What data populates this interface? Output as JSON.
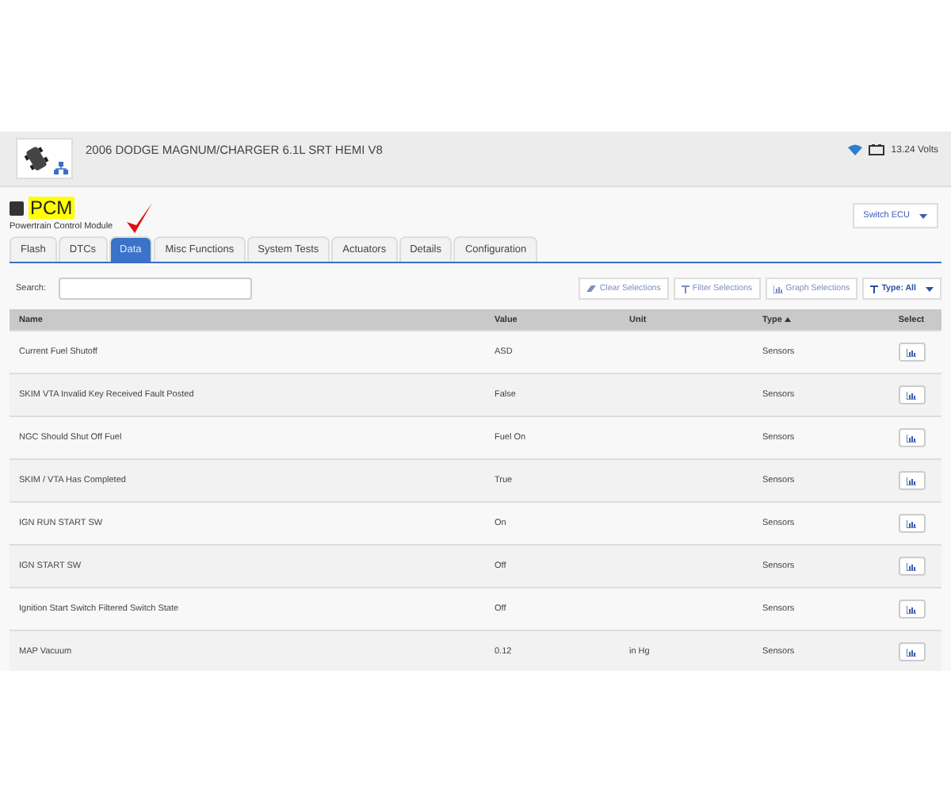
{
  "header": {
    "vehicle": "2006 DODGE MAGNUM/CHARGER 6.1L SRT HEMI V8",
    "voltage": "13.24 Volts"
  },
  "module": {
    "code": "PCM",
    "name": "Powertrain Control Module",
    "switch_button": "Switch ECU"
  },
  "tabs": [
    {
      "label": "Flash",
      "selected": false
    },
    {
      "label": "DTCs",
      "selected": false
    },
    {
      "label": "Data",
      "selected": true
    },
    {
      "label": "Misc Functions",
      "selected": false
    },
    {
      "label": "System Tests",
      "selected": false
    },
    {
      "label": "Actuators",
      "selected": false
    },
    {
      "label": "Details",
      "selected": false
    },
    {
      "label": "Configuration",
      "selected": false
    }
  ],
  "search": {
    "label": "Search:"
  },
  "toolbar": [
    {
      "label": "Clear Selections",
      "kind": "clear"
    },
    {
      "label": "Filter Selections",
      "kind": "filter"
    },
    {
      "label": "Graph Selections",
      "kind": "graph"
    },
    {
      "label": "Type: All",
      "kind": "dropdown"
    }
  ],
  "table": {
    "columns": [
      "Name",
      "Value",
      "Unit",
      "Type",
      "Select"
    ],
    "rows": [
      {
        "name": "Current Fuel Shutoff",
        "value": "ASD",
        "unit": "",
        "type": "Sensors"
      },
      {
        "name": "SKIM VTA Invalid Key Received Fault Posted",
        "value": "False",
        "unit": "",
        "type": "Sensors"
      },
      {
        "name": "NGC Should Shut Off Fuel",
        "value": "Fuel On",
        "unit": "",
        "type": "Sensors"
      },
      {
        "name": "SKIM / VTA Has Completed",
        "value": "True",
        "unit": "",
        "type": "Sensors"
      },
      {
        "name": "IGN RUN START SW",
        "value": "On",
        "unit": "",
        "type": "Sensors"
      },
      {
        "name": "IGN START SW",
        "value": "Off",
        "unit": "",
        "type": "Sensors"
      },
      {
        "name": "Ignition Start Switch Filtered Switch State",
        "value": "Off",
        "unit": "",
        "type": "Sensors"
      },
      {
        "name": "MAP Vacuum",
        "value": "0.12",
        "unit": "in Hg",
        "type": "Sensors"
      }
    ]
  }
}
